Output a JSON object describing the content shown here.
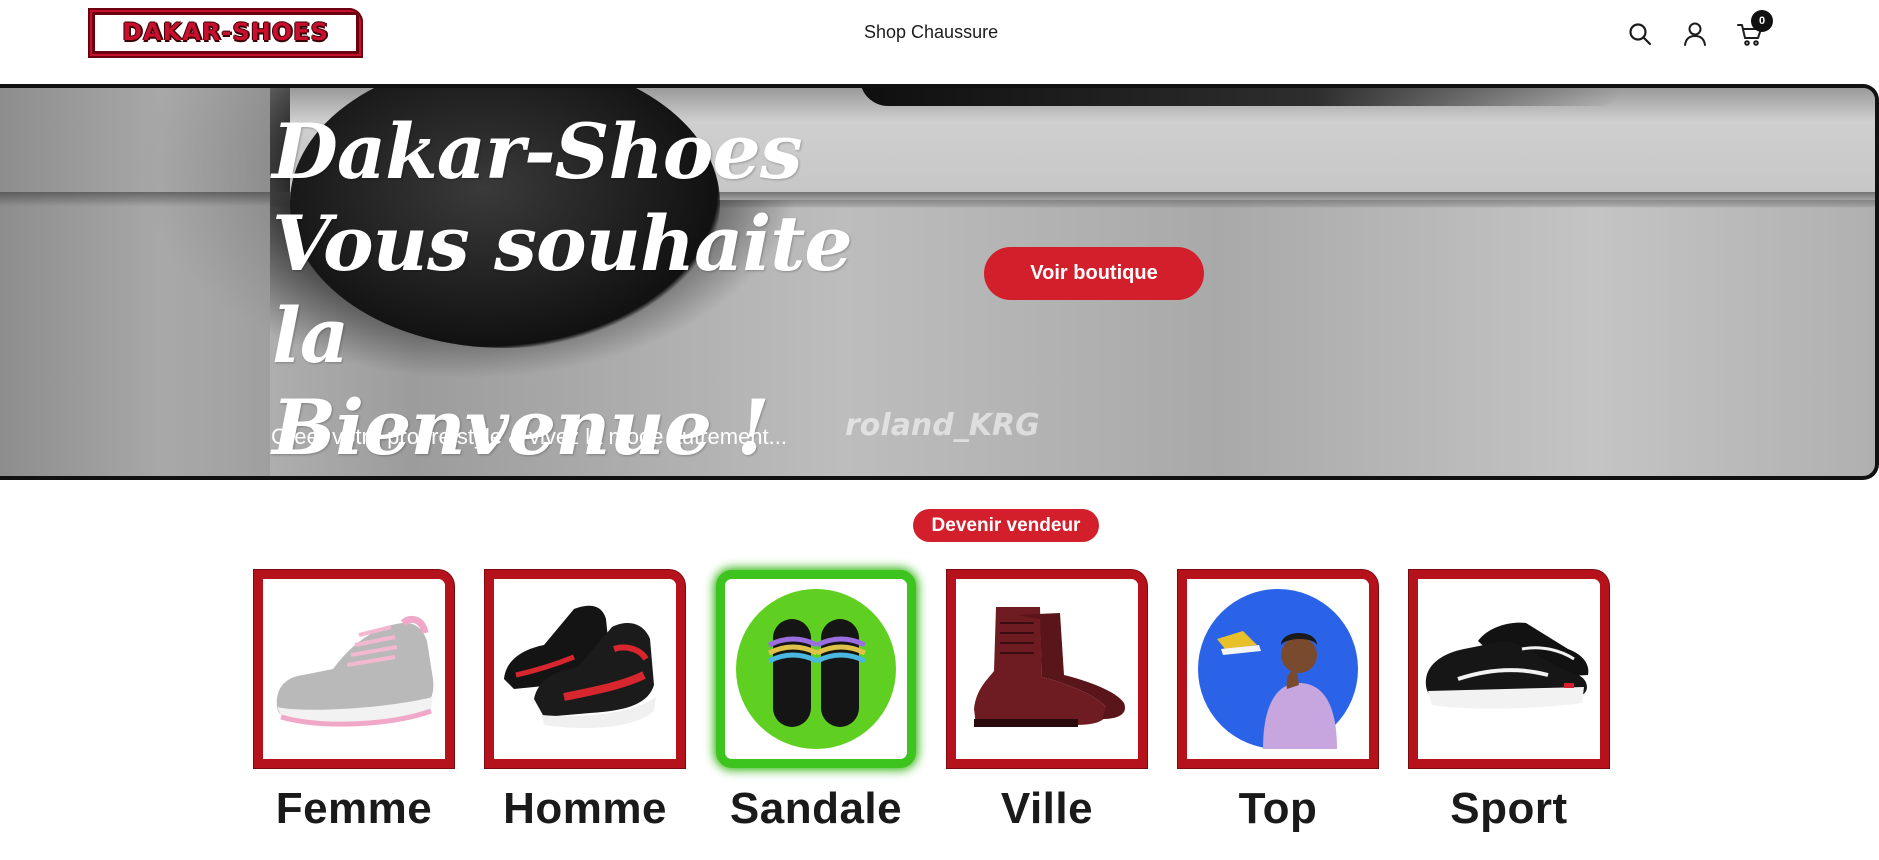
{
  "header": {
    "logo_text": "DAKAR-SHOES",
    "nav_link": "Shop Chaussure",
    "icons": [
      "search-icon",
      "user-icon",
      "cart-icon"
    ],
    "cart_count": "0"
  },
  "hero": {
    "title_line1": "Dakar-Shoes",
    "title_line2": "Vous souhaite la",
    "title_line3": "Bienvenue !",
    "subtitle": "Creer votre propre style & vivez la mode autrement...",
    "watermark": "roland_KRG",
    "button_label": "Voir boutique"
  },
  "vendor_button": "Devenir vendeur",
  "categories": [
    {
      "label": "Femme",
      "active": false
    },
    {
      "label": "Homme",
      "active": false
    },
    {
      "label": "Sandale",
      "active": true
    },
    {
      "label": "Ville",
      "active": false
    },
    {
      "label": "Top",
      "active": false
    },
    {
      "label": "Sport",
      "active": false
    }
  ],
  "colors": {
    "accent_red": "#d21f2b",
    "frame_red": "#b5121b",
    "active_green": "#3ec41e"
  }
}
